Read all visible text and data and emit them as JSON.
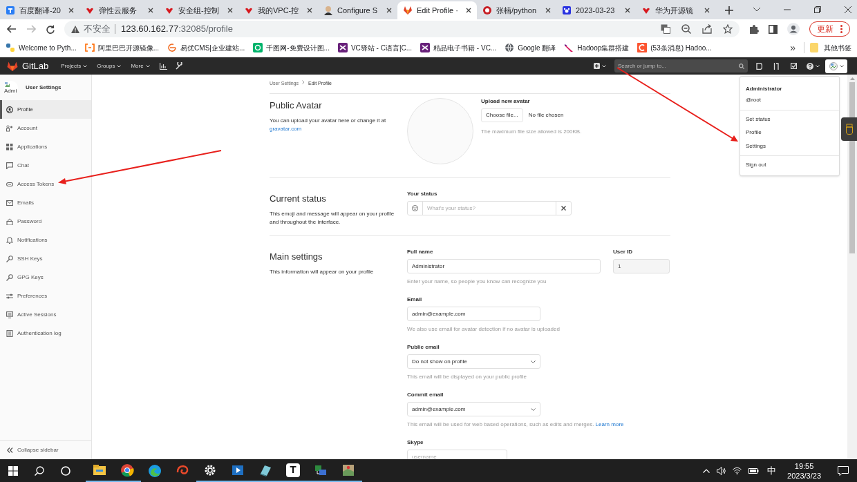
{
  "browser": {
    "tabs": [
      {
        "label": "百度翻译-20",
        "selected": false
      },
      {
        "label": "弹性云服务",
        "selected": false
      },
      {
        "label": "安全组-控制",
        "selected": false
      },
      {
        "label": "我的VPC-控",
        "selected": false
      },
      {
        "label": "Configure S",
        "selected": false
      },
      {
        "label": "Edit Profile ·",
        "selected": true
      },
      {
        "label": "张楠/python",
        "selected": false
      },
      {
        "label": "2023-03-23",
        "selected": false
      },
      {
        "label": "华为开源镜",
        "selected": false
      }
    ],
    "security_label": "不安全",
    "url_host": "123.60.162.77",
    "url_rest": ":32085/profile",
    "update_button": "更新",
    "bookmarks": [
      "Welcome to Pyth...",
      "阿里巴巴开源镜像...",
      "易优CMS|企业建站...",
      "千图网-免费设计图...",
      "VC驿站 - C语言|C...",
      "精品电子书籍 - VC...",
      "Google 翻译",
      "Hadoop集群搭建",
      "(53条消息) Hadoo..."
    ],
    "bookmarks_more": "»",
    "other_bookmarks": "其他书签"
  },
  "gitlab": {
    "brand": "GitLab",
    "nav": [
      "Projects",
      "Groups",
      "More"
    ],
    "search_placeholder": "Search or jump to..."
  },
  "sidebar": {
    "avatar_alt": "Admi",
    "title": "User Settings",
    "items": [
      {
        "label": "Profile",
        "selected": true
      },
      {
        "label": "Account",
        "selected": false
      },
      {
        "label": "Applications",
        "selected": false
      },
      {
        "label": "Chat",
        "selected": false
      },
      {
        "label": "Access Tokens",
        "selected": false
      },
      {
        "label": "Emails",
        "selected": false
      },
      {
        "label": "Password",
        "selected": false
      },
      {
        "label": "Notifications",
        "selected": false
      },
      {
        "label": "SSH Keys",
        "selected": false
      },
      {
        "label": "GPG Keys",
        "selected": false
      },
      {
        "label": "Preferences",
        "selected": false
      },
      {
        "label": "Active Sessions",
        "selected": false
      },
      {
        "label": "Authentication log",
        "selected": false
      }
    ],
    "collapse": "Collapse sidebar"
  },
  "breadcrumb": [
    "User Settings",
    "Edit Profile"
  ],
  "public_avatar": {
    "title": "Public Avatar",
    "description": "You can upload your avatar here or change it at",
    "link": "gravatar.com",
    "upload_label": "Upload new avatar",
    "choose_button": "Choose file...",
    "file_status": "No file chosen",
    "hint": "The maximum file size allowed is 200KB."
  },
  "current_status": {
    "title": "Current status",
    "description": "This emoji and message will appear on your profile and throughout the interface.",
    "label": "Your status",
    "placeholder": "What's your status?"
  },
  "main_settings": {
    "title": "Main settings",
    "description": "This information will appear on your profile",
    "full_name": {
      "label": "Full name",
      "value": "Administrator",
      "hint": "Enter your name, so people you know can recognize you"
    },
    "user_id": {
      "label": "User ID",
      "value": "1",
      "disabled": true
    },
    "fields": [
      {
        "kind": "input",
        "label": "Email",
        "value": "admin@example.com",
        "hint": "We also use email for avatar detection if no avatar is uploaded"
      },
      {
        "kind": "select",
        "label": "Public email",
        "value": "Do not show on profile",
        "hint": "This email will be displayed on your public profile"
      },
      {
        "kind": "select",
        "label": "Commit email",
        "value": "admin@example.com",
        "hint": "This email will be used for web based operations, such as edits and merges.",
        "link": "Learn more"
      },
      {
        "kind": "input",
        "label": "Skype",
        "placeholder": "username"
      }
    ]
  },
  "user_menu": {
    "name": "Administrator",
    "handle": "@root",
    "items": [
      "Set status",
      "Profile",
      "Settings"
    ],
    "sign_out": "Sign out"
  },
  "taskbar": {
    "app_letter": "T",
    "ime": "中",
    "time": "19:55",
    "date": "2023/3/23"
  }
}
